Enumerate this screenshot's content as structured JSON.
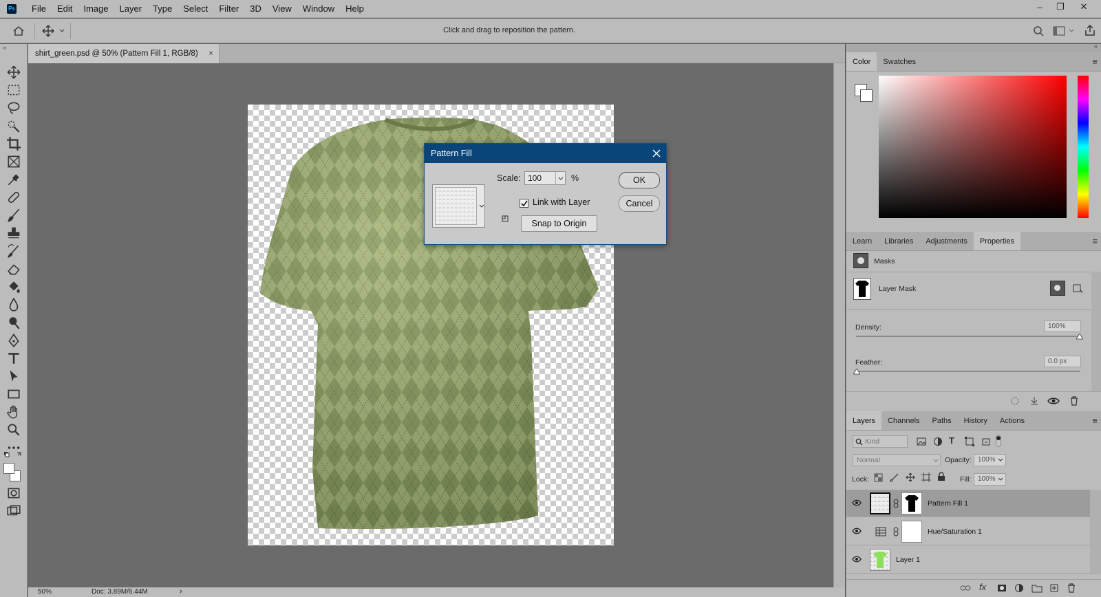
{
  "app": {
    "logo": "Ps"
  },
  "menu": [
    "File",
    "Edit",
    "Image",
    "Layer",
    "Type",
    "Select",
    "Filter",
    "3D",
    "View",
    "Window",
    "Help"
  ],
  "window_controls": {
    "minimize": "–",
    "restore": "❐",
    "close": "✕"
  },
  "options_bar": {
    "hint": "Click and drag to reposition the pattern."
  },
  "document": {
    "tab_title": "shirt_green.psd @ 50% (Pattern Fill 1, RGB/8)",
    "tab_close": "×"
  },
  "status": {
    "zoom": "50%",
    "doc": "Doc: 3.89M/6.44M",
    "arrow": "›"
  },
  "dialog": {
    "title": "Pattern Fill",
    "scale_label": "Scale:",
    "scale_value": "100",
    "percent": "%",
    "link_label": "Link with Layer",
    "link_checked": true,
    "snap_button": "Snap to Origin",
    "ok": "OK",
    "cancel": "Cancel"
  },
  "color_panel": {
    "tabs": [
      "Color",
      "Swatches"
    ],
    "active": "Color"
  },
  "properties_panel": {
    "tabs": [
      "Learn",
      "Libraries",
      "Adjustments",
      "Properties"
    ],
    "active": "Properties",
    "section": "Masks",
    "mask_label": "Layer Mask",
    "density_label": "Density:",
    "density_value": "100%",
    "feather_label": "Feather:",
    "feather_value": "0.0 px"
  },
  "layers_panel": {
    "tabs": [
      "Layers",
      "Channels",
      "Paths",
      "History",
      "Actions"
    ],
    "active": "Layers",
    "kind_placeholder": "Kind",
    "blend_mode": "Normal",
    "opacity_label": "Opacity:",
    "opacity_value": "100%",
    "lock_label": "Lock:",
    "fill_label": "Fill:",
    "fill_value": "100%",
    "layers": [
      {
        "name": "Pattern Fill 1",
        "selected": true
      },
      {
        "name": "Hue/Saturation 1",
        "selected": false
      },
      {
        "name": "Layer 1",
        "selected": false
      }
    ]
  },
  "colors": {
    "dialog_title_bg": "#0a4579",
    "shirt": "#8fa26a",
    "layer_thumb": "#8ee05a"
  }
}
